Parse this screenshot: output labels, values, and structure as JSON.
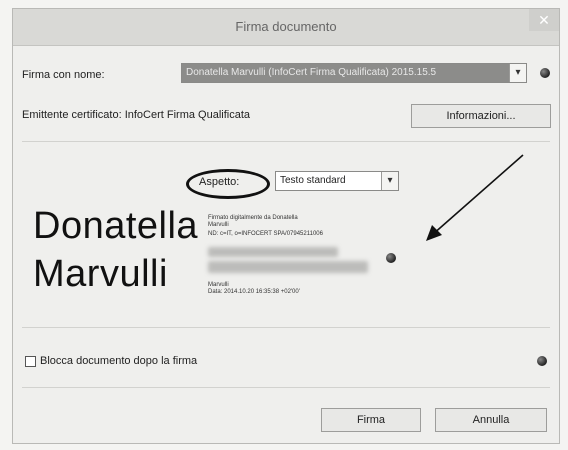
{
  "dialog": {
    "title": "Firma documento",
    "close_glyph": "✕"
  },
  "signer": {
    "label": "Firma con nome:",
    "selected_value": "Donatella Marvulli (InfoCert Firma Qualificata) 2015.15.5"
  },
  "issuer": {
    "text": "Emittente certificato: InfoCert Firma Qualificata",
    "info_button": "Informazioni..."
  },
  "appearance": {
    "label": "Aspetto:",
    "selected_value": "Testo standard"
  },
  "signature_preview": {
    "name_line1": "Donatella",
    "name_line2": "Marvulli",
    "detail_line1": "Firmato digitalmente da Donatella",
    "detail_line2": "Marvulli",
    "detail_line3": "ND: c=IT, o=INFOCERT SPA/07945211006",
    "detail_line4": "Marvulli",
    "detail_line5": "Data: 2014.10.20 16:35:38 +02'00'"
  },
  "lock_option": {
    "label": "Blocca documento dopo la firma",
    "checked": false
  },
  "buttons": {
    "sign": "Firma",
    "cancel": "Annulla"
  },
  "icons": {
    "help": "help-dot-icon",
    "annotation_arrow": "arrow-icon",
    "chevron": "chevron-down-icon"
  }
}
